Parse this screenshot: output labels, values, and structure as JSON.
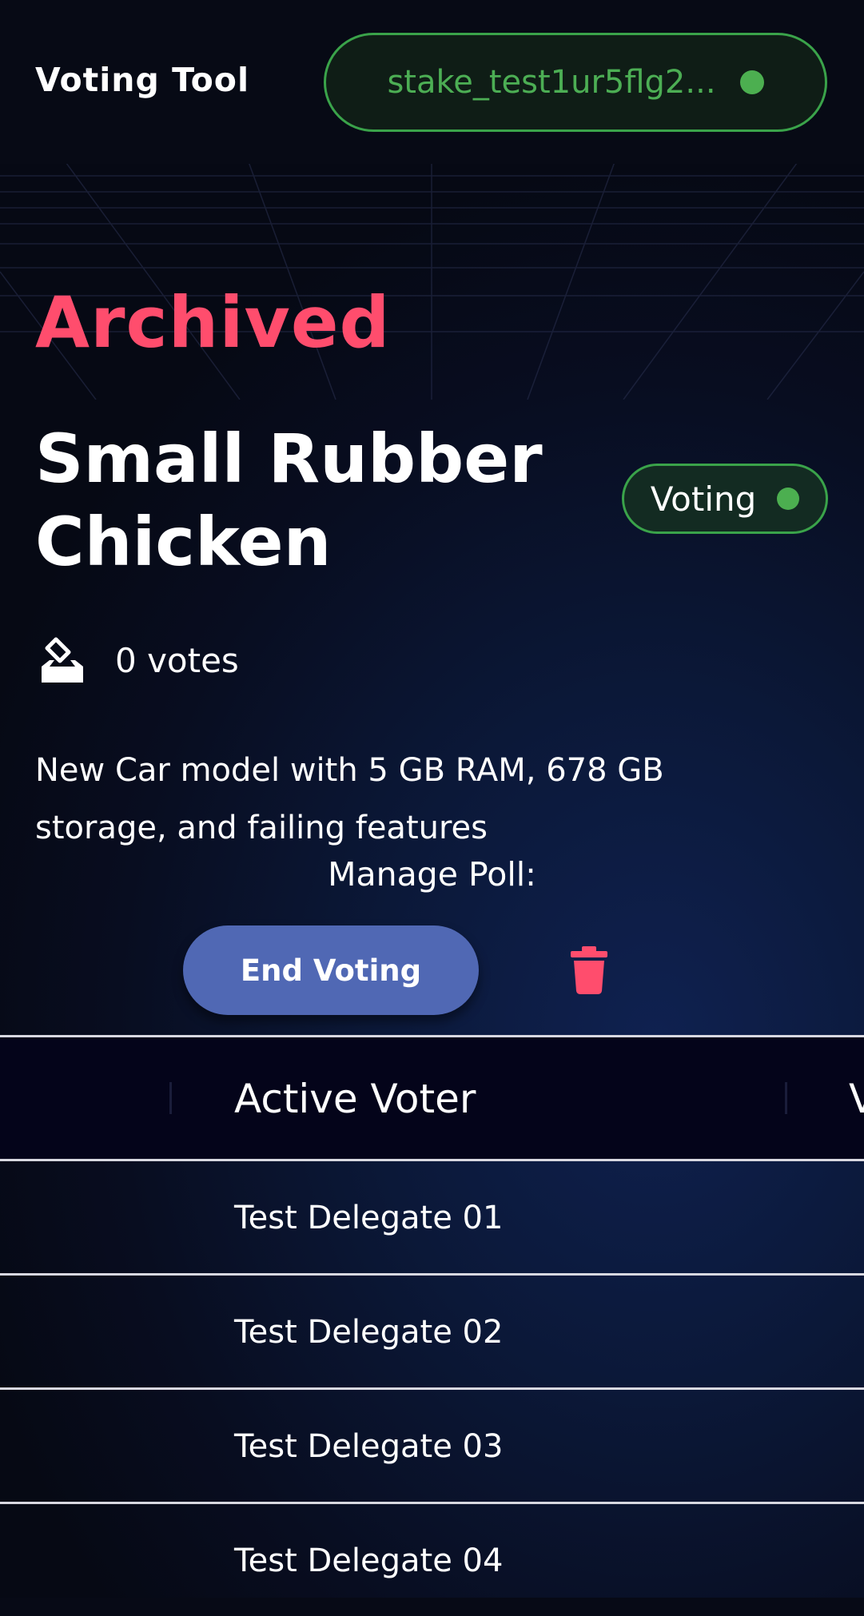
{
  "header": {
    "app_title": "Voting Tool",
    "wallet_address": "stake_test1ur5flg2...",
    "wallet_status_color": "#4caf50"
  },
  "poll": {
    "archived_label": "Archived",
    "title": "Small Rubber Chicken",
    "status_label": "Voting",
    "votes_label": "0 votes",
    "description": "New Car model with 5 GB RAM, 678 GB storage, and failing features"
  },
  "manage": {
    "label": "Manage Poll:",
    "end_voting_label": "End Voting",
    "delete_icon": "trash-icon"
  },
  "table": {
    "columns": [
      "Active Voter",
      "V"
    ],
    "rows": [
      {
        "name": "Test Delegate 01"
      },
      {
        "name": "Test Delegate 02"
      },
      {
        "name": "Test Delegate 03"
      },
      {
        "name": "Test Delegate 04"
      }
    ]
  },
  "colors": {
    "accent_red": "#ff4d6d",
    "accent_green": "#4caf50",
    "button_blue": "#5068b4",
    "background": "#070a16"
  }
}
